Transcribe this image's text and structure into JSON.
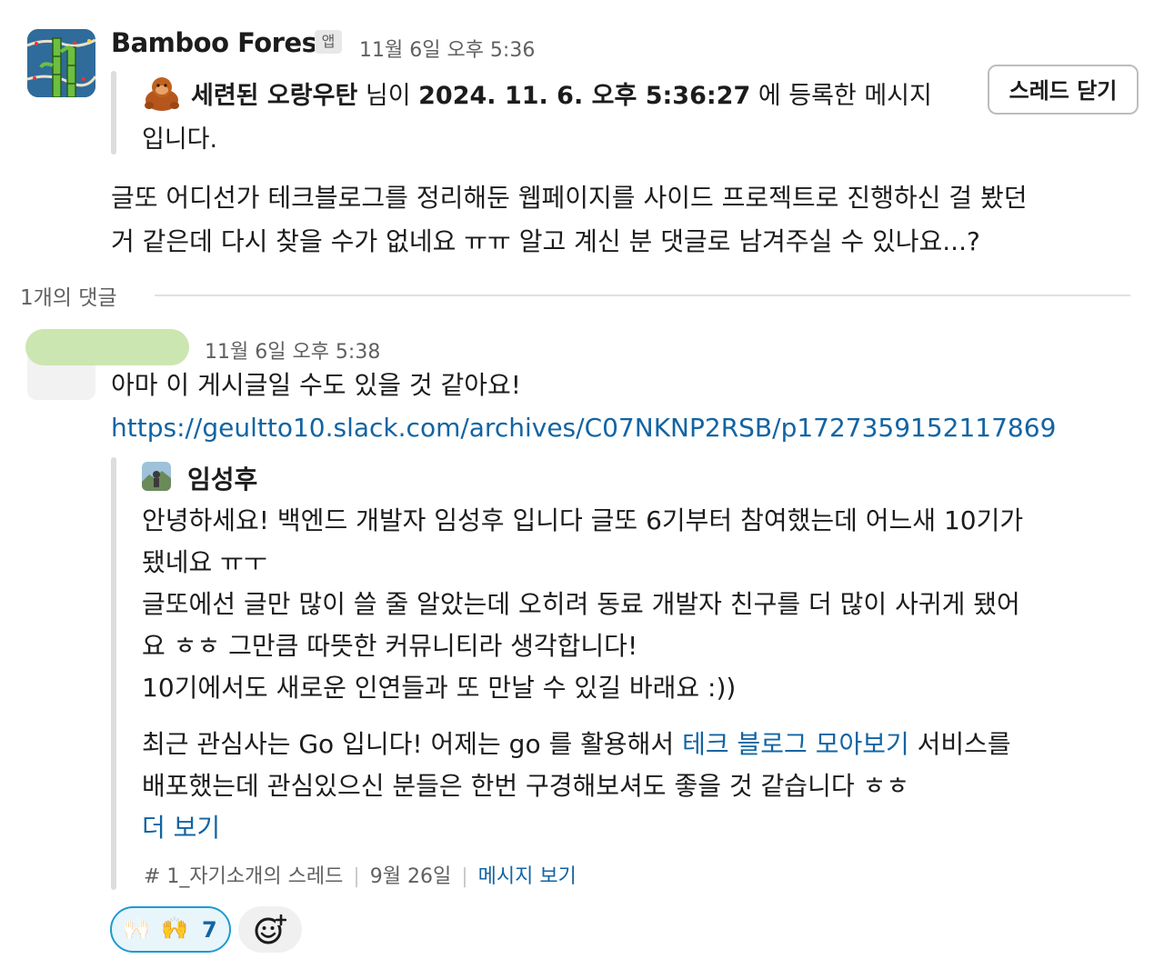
{
  "message": {
    "sender": "Bamboo Forest",
    "badge": "앱",
    "timestamp": "11월 6일 오후 5:36",
    "quote": {
      "author": "세련된 오랑우탄",
      "middle": " 님이 ",
      "date": "2024. 11. 6. 오후 5:36:27",
      "suffix": " 에 등록한 메시지",
      "line2": "입니다."
    },
    "close_thread_label": "스레드 닫기",
    "body_line1": "글또 어디선가 테크블로그를 정리해둔 웹페이지를 사이드 프로젝트로 진행하신 걸 봤던",
    "body_line2": "거 같은데 다시 찾을 수가 없네요 ㅠㅠ 알고 계신 분 댓글로 남겨주실 수 있나요...?"
  },
  "reply_count_label": "1개의 댓글",
  "reply": {
    "timestamp": "11월 6일 오후 5:38",
    "text": "아마 이 게시글일 수도 있을 것 같아요!",
    "url": "https://geultto10.slack.com/archives/C07NKNP2RSB/p1727359152117869",
    "unfurl": {
      "author": "임성후",
      "line1": "안녕하세요! 백엔드 개발자 임성후 입니다 글또 6기부터 참여했는데 어느새 10기가",
      "line2": "됐네요 ㅠㅜ",
      "line3": "글또에선 글만 많이 쓸 줄 알았는데 오히려 동료 개발자 친구를 더 많이 사귀게 됐어",
      "line4": "요 ㅎㅎ 그만큼 따뜻한 커뮤니티라 생각합니다!",
      "line5": "10기에서도 새로운 인연들과 또 만날 수 있길 바래요 :))",
      "line6_pre": "최근 관심사는 Go 입니다! 어제는 go 를 활용해서 ",
      "line6_link": "테크 블로그 모아보기",
      "line6_post": " 서비스를",
      "line7": "배포했는데 관심있으신 분들은 한번 구경해보셔도 좋을 것 같습니다 ㅎㅎ",
      "more_label": "더 보기",
      "channel": "# 1_자기소개의 스레드",
      "date": "9월 26일",
      "view_label": "메시지 보기"
    }
  },
  "reactions": {
    "emojis": [
      "🙌🏻",
      "🙌"
    ],
    "count": "7",
    "add_icon": "add-reaction-icon"
  }
}
